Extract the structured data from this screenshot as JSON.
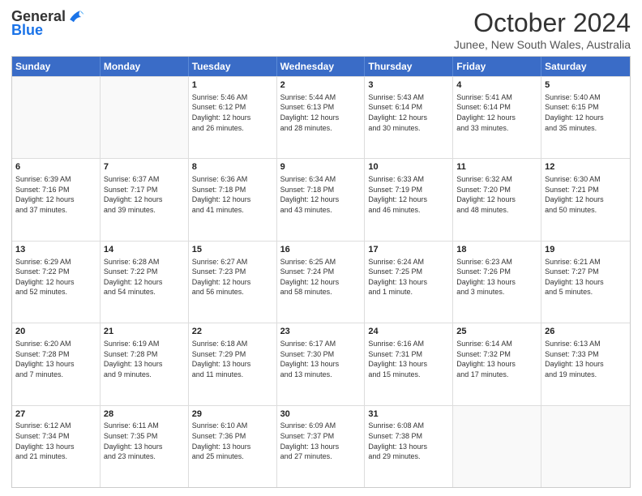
{
  "logo": {
    "general": "General",
    "blue": "Blue"
  },
  "title": "October 2024",
  "subtitle": "Junee, New South Wales, Australia",
  "headers": [
    "Sunday",
    "Monday",
    "Tuesday",
    "Wednesday",
    "Thursday",
    "Friday",
    "Saturday"
  ],
  "rows": [
    [
      {
        "num": "",
        "info": "",
        "empty": true
      },
      {
        "num": "",
        "info": "",
        "empty": true
      },
      {
        "num": "1",
        "info": "Sunrise: 5:46 AM\nSunset: 6:12 PM\nDaylight: 12 hours\nand 26 minutes."
      },
      {
        "num": "2",
        "info": "Sunrise: 5:44 AM\nSunset: 6:13 PM\nDaylight: 12 hours\nand 28 minutes."
      },
      {
        "num": "3",
        "info": "Sunrise: 5:43 AM\nSunset: 6:14 PM\nDaylight: 12 hours\nand 30 minutes."
      },
      {
        "num": "4",
        "info": "Sunrise: 5:41 AM\nSunset: 6:14 PM\nDaylight: 12 hours\nand 33 minutes."
      },
      {
        "num": "5",
        "info": "Sunrise: 5:40 AM\nSunset: 6:15 PM\nDaylight: 12 hours\nand 35 minutes."
      }
    ],
    [
      {
        "num": "6",
        "info": "Sunrise: 6:39 AM\nSunset: 7:16 PM\nDaylight: 12 hours\nand 37 minutes."
      },
      {
        "num": "7",
        "info": "Sunrise: 6:37 AM\nSunset: 7:17 PM\nDaylight: 12 hours\nand 39 minutes."
      },
      {
        "num": "8",
        "info": "Sunrise: 6:36 AM\nSunset: 7:18 PM\nDaylight: 12 hours\nand 41 minutes."
      },
      {
        "num": "9",
        "info": "Sunrise: 6:34 AM\nSunset: 7:18 PM\nDaylight: 12 hours\nand 43 minutes."
      },
      {
        "num": "10",
        "info": "Sunrise: 6:33 AM\nSunset: 7:19 PM\nDaylight: 12 hours\nand 46 minutes."
      },
      {
        "num": "11",
        "info": "Sunrise: 6:32 AM\nSunset: 7:20 PM\nDaylight: 12 hours\nand 48 minutes."
      },
      {
        "num": "12",
        "info": "Sunrise: 6:30 AM\nSunset: 7:21 PM\nDaylight: 12 hours\nand 50 minutes."
      }
    ],
    [
      {
        "num": "13",
        "info": "Sunrise: 6:29 AM\nSunset: 7:22 PM\nDaylight: 12 hours\nand 52 minutes."
      },
      {
        "num": "14",
        "info": "Sunrise: 6:28 AM\nSunset: 7:22 PM\nDaylight: 12 hours\nand 54 minutes."
      },
      {
        "num": "15",
        "info": "Sunrise: 6:27 AM\nSunset: 7:23 PM\nDaylight: 12 hours\nand 56 minutes."
      },
      {
        "num": "16",
        "info": "Sunrise: 6:25 AM\nSunset: 7:24 PM\nDaylight: 12 hours\nand 58 minutes."
      },
      {
        "num": "17",
        "info": "Sunrise: 6:24 AM\nSunset: 7:25 PM\nDaylight: 13 hours\nand 1 minute."
      },
      {
        "num": "18",
        "info": "Sunrise: 6:23 AM\nSunset: 7:26 PM\nDaylight: 13 hours\nand 3 minutes."
      },
      {
        "num": "19",
        "info": "Sunrise: 6:21 AM\nSunset: 7:27 PM\nDaylight: 13 hours\nand 5 minutes."
      }
    ],
    [
      {
        "num": "20",
        "info": "Sunrise: 6:20 AM\nSunset: 7:28 PM\nDaylight: 13 hours\nand 7 minutes."
      },
      {
        "num": "21",
        "info": "Sunrise: 6:19 AM\nSunset: 7:28 PM\nDaylight: 13 hours\nand 9 minutes."
      },
      {
        "num": "22",
        "info": "Sunrise: 6:18 AM\nSunset: 7:29 PM\nDaylight: 13 hours\nand 11 minutes."
      },
      {
        "num": "23",
        "info": "Sunrise: 6:17 AM\nSunset: 7:30 PM\nDaylight: 13 hours\nand 13 minutes."
      },
      {
        "num": "24",
        "info": "Sunrise: 6:16 AM\nSunset: 7:31 PM\nDaylight: 13 hours\nand 15 minutes."
      },
      {
        "num": "25",
        "info": "Sunrise: 6:14 AM\nSunset: 7:32 PM\nDaylight: 13 hours\nand 17 minutes."
      },
      {
        "num": "26",
        "info": "Sunrise: 6:13 AM\nSunset: 7:33 PM\nDaylight: 13 hours\nand 19 minutes."
      }
    ],
    [
      {
        "num": "27",
        "info": "Sunrise: 6:12 AM\nSunset: 7:34 PM\nDaylight: 13 hours\nand 21 minutes."
      },
      {
        "num": "28",
        "info": "Sunrise: 6:11 AM\nSunset: 7:35 PM\nDaylight: 13 hours\nand 23 minutes."
      },
      {
        "num": "29",
        "info": "Sunrise: 6:10 AM\nSunset: 7:36 PM\nDaylight: 13 hours\nand 25 minutes."
      },
      {
        "num": "30",
        "info": "Sunrise: 6:09 AM\nSunset: 7:37 PM\nDaylight: 13 hours\nand 27 minutes."
      },
      {
        "num": "31",
        "info": "Sunrise: 6:08 AM\nSunset: 7:38 PM\nDaylight: 13 hours\nand 29 minutes."
      },
      {
        "num": "",
        "info": "",
        "empty": true
      },
      {
        "num": "",
        "info": "",
        "empty": true
      }
    ]
  ]
}
